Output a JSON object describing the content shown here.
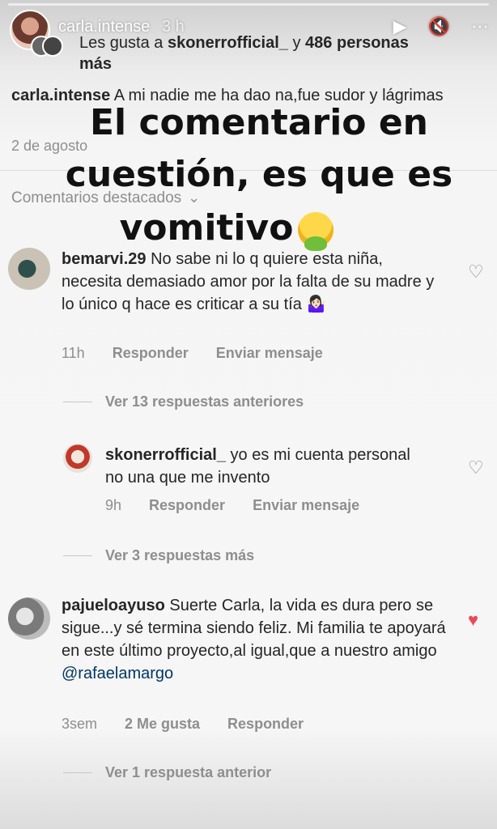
{
  "story": {
    "username": "carla.intense",
    "time": "3 h",
    "controls": [
      "▶",
      "🔇",
      "⋯"
    ]
  },
  "post": {
    "likes_prefix": "Les gusta a ",
    "likes_user": "skonerrofficial_",
    "likes_middle": " y ",
    "likes_count": "486 personas",
    "likes_suffix": "más",
    "caption_user": "carla.intense",
    "caption_text": " A mi nadie me ha dao na,fue sudor y lágrimas",
    "date": "2 de agosto",
    "featured_label": "Comentarios destacados",
    "featured_chevron": "⌄"
  },
  "overlay": {
    "line1": "El comentario en",
    "line2": "cuestión, es que es",
    "line3": "vomitivo"
  },
  "comments": [
    {
      "user": "bemarvi.29",
      "text": " No sabe ni lo q quiere esta niña, necesita demasiado amor por la falta de su madre y lo único q hace es criticar a su tía 🤷🏻‍♀️",
      "time": "11h",
      "reply": "Responder",
      "send": "Enviar mensaje",
      "liked": false
    },
    {
      "user": "skonerrofficial_",
      "text": " yo es mi cuenta personal no una que me invento",
      "time": "9h",
      "reply": "Responder",
      "send": "Enviar mensaje",
      "liked": false
    },
    {
      "user": "pajueloayuso",
      "text": " Suerte Carla, la vida es dura pero se sigue...y sé termina siendo feliz. Mi familia te apoyará en este último proyecto,al igual,que a nuestro amigo",
      "mention": "@rafaelamargo",
      "time": "3sem",
      "likes": "2 Me gusta",
      "reply": "Responder",
      "liked": true
    }
  ],
  "view_replies": {
    "first": "Ver 13 respuestas anteriores",
    "second": "Ver 3 respuestas más",
    "third": "Ver 1 respuesta anterior"
  },
  "colors": {
    "like_red": "#ed4956",
    "meta_gray": "#8e8e8e",
    "mention_blue": "#00376b"
  }
}
